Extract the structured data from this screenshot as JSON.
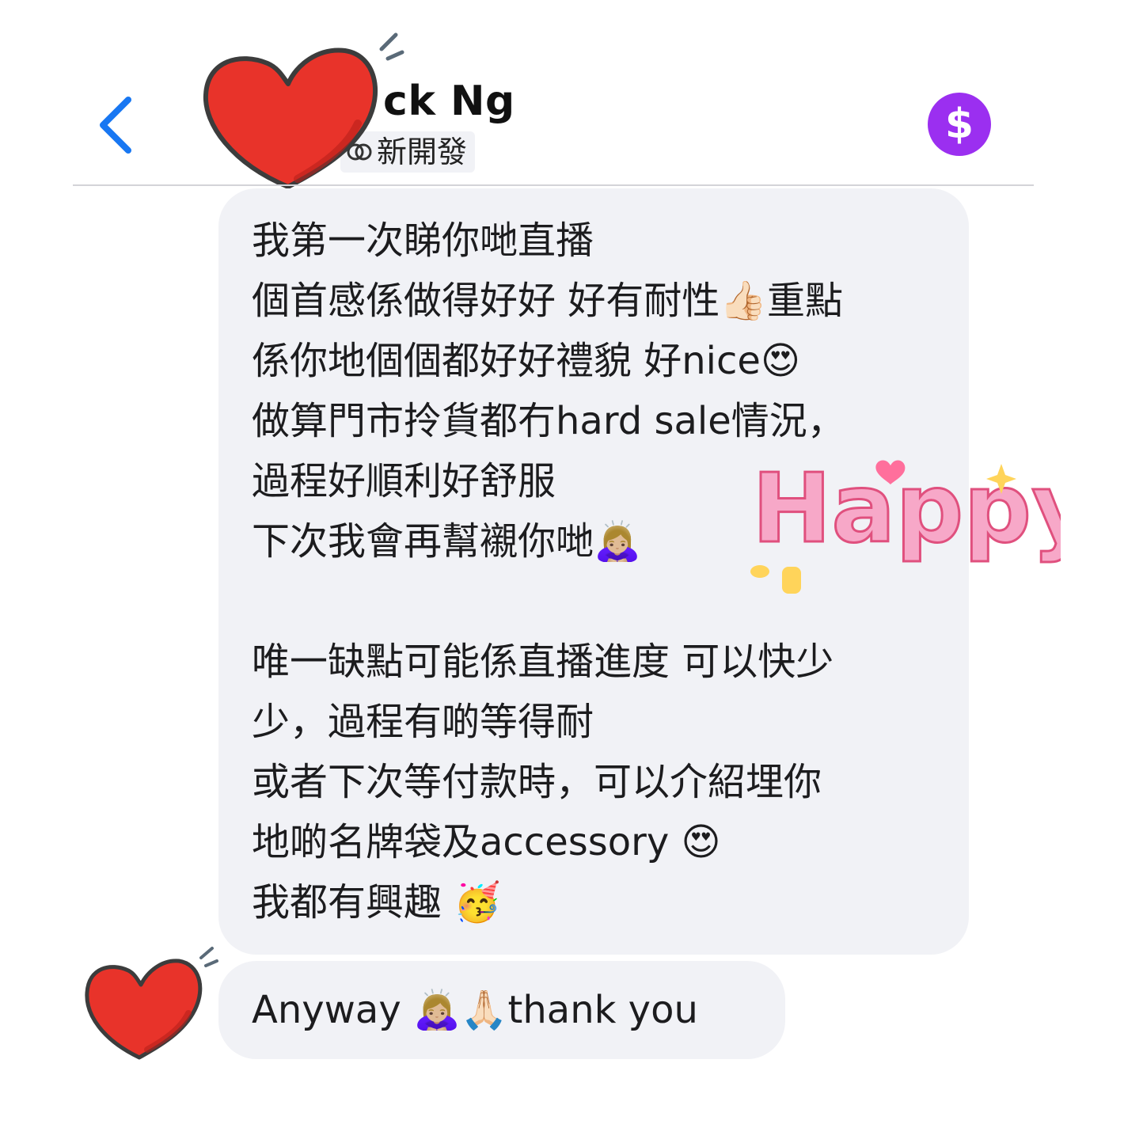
{
  "header": {
    "contact_name": "ck Ng",
    "contact_tag": "新開發",
    "payment_icon": "dollar-icon",
    "back_icon": "chevron-left-icon"
  },
  "messages": {
    "main_lines": [
      "我第一次睇你哋直播",
      "個首感係做得好好 好有耐性👍🏻重點",
      "係你地個個都好好禮貌 好nice😍",
      "做算門市拎貨都冇hard sale情況，",
      "過程好順利好舒服",
      "下次我會再幫襯你哋🙇🏼‍♀️",
      "",
      "唯一缺點可能係直播進度 可以快少",
      "少，過程有啲等得耐",
      "或者下次等付款時，可以介紹埋你",
      "地啲名牌袋及accessory 😍",
      "我都有興趣 🥳"
    ],
    "reply": "Anyway 🙇🏼‍♀️🙏🏻thank you"
  },
  "stickers": {
    "happy_text": "Happy",
    "heart_icon": "heart-icon"
  },
  "colors": {
    "accent_blue": "#1877f2",
    "pay_purple": "#9b2ff0",
    "bubble_bg": "#f1f2f6",
    "heart_red": "#e8332a"
  }
}
